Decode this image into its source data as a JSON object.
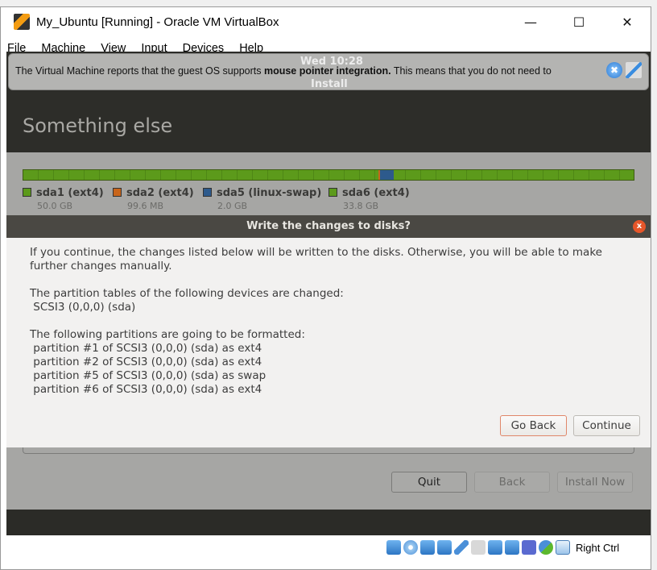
{
  "window": {
    "title": "My_Ubuntu [Running] - Oracle VM VirtualBox",
    "controls": [
      "minimize",
      "maximize",
      "close"
    ]
  },
  "menu": [
    "File",
    "Machine",
    "View",
    "Input",
    "Devices",
    "Help"
  ],
  "notification": {
    "clock": "Wed 10:28",
    "underlay": "Install",
    "text_pre": "The Virtual Machine reports that the guest OS supports ",
    "text_bold": "mouse pointer integration.",
    "text_post": " This means that you do not need to"
  },
  "installer": {
    "heading": "Something else",
    "partitions": [
      {
        "name": "sda1 (ext4)",
        "size": "50.0 GB",
        "color": "#5c9a1b"
      },
      {
        "name": "sda2 (ext4)",
        "size": "99.6 MB",
        "color": "#c8651b"
      },
      {
        "name": "sda5 (linux-swap)",
        "size": "2.0 GB",
        "color": "#2d5a8c"
      },
      {
        "name": "sda6 (ext4)",
        "size": "33.8 GB",
        "color": "#5c9a1b"
      }
    ],
    "buttons": {
      "quit": "Quit",
      "back": "Back",
      "install": "Install Now"
    }
  },
  "dialog": {
    "title": "Write the changes to disks?",
    "intro": "If you continue, the changes listed below will be written to the disks. Otherwise, you will be able to make further changes manually.",
    "tables_heading": "The partition tables of the following devices are changed:",
    "tables": [
      " SCSI3 (0,0,0) (sda)"
    ],
    "format_heading": "The following partitions are going to be formatted:",
    "formats": [
      " partition #1 of SCSI3 (0,0,0) (sda) as ext4",
      " partition #2 of SCSI3 (0,0,0) (sda) as ext4",
      " partition #5 of SCSI3 (0,0,0) (sda) as swap",
      " partition #6 of SCSI3 (0,0,0) (sda) as ext4"
    ],
    "go_back": "Go Back",
    "continue": "Continue"
  },
  "statusbar": {
    "icons": [
      "hard-disk",
      "optical-drive",
      "audio",
      "network",
      "usb",
      "shared-folders",
      "display",
      "video-capture",
      "cpu",
      "mouse-integration",
      "keyboard-capture"
    ],
    "host_key": "Right Ctrl"
  }
}
